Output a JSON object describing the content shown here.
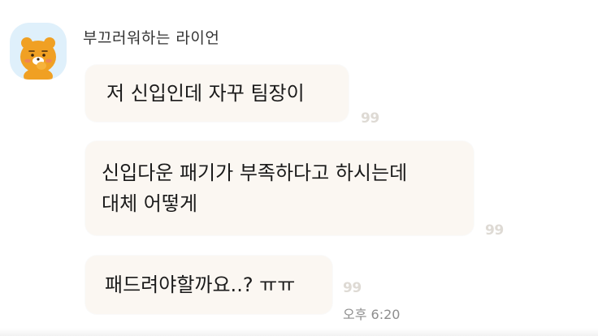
{
  "sender": {
    "name": "부끄러워하는 라이언"
  },
  "avatar": {
    "icon": "ryan-bear-icon",
    "background": "#dff0fb",
    "character_color": "#f0a023"
  },
  "messages": [
    {
      "text": "저 신입인데 자꾸 팀장이",
      "read_count": "99"
    },
    {
      "text": "신입다운 패기가 부족하다고 하시는데\n대체 어떻게",
      "read_count": "99"
    },
    {
      "text": "패드려야할까요..? ㅠㅠ",
      "read_count": "99",
      "time": "오후 6:20"
    }
  ],
  "colors": {
    "bubble": "#fbf7f2",
    "read_count": "#dedad4",
    "text": "#1a1a1a"
  }
}
